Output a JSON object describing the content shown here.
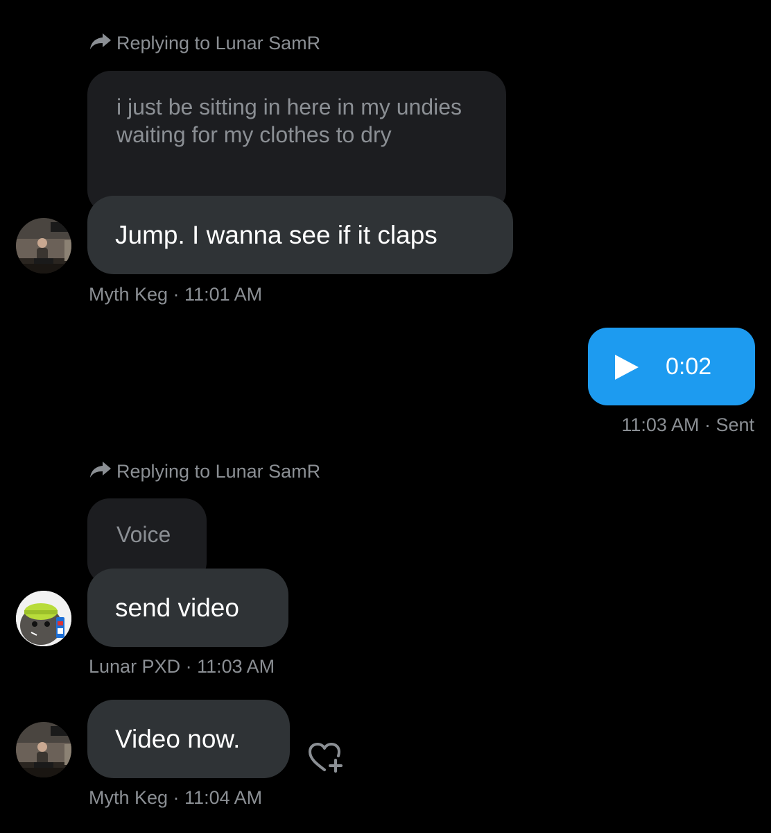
{
  "messages": [
    {
      "reply_prefix": "Replying to Lunar SamR",
      "quoted_text": "i just be sitting in here in my undies waiting for my clothes to dry",
      "text": "Jump. I wanna see if it claps",
      "meta": "Myth Keg · 11:01 AM"
    },
    {
      "voice_duration": "0:02",
      "meta": "11:03 AM · Sent"
    },
    {
      "reply_prefix": "Replying to Lunar SamR",
      "quoted_text": "Voice",
      "text": "send video",
      "meta": "Lunar PXD · 11:03 AM"
    },
    {
      "text": "Video now.",
      "meta": "Myth Keg · 11:04 AM"
    }
  ],
  "colors": {
    "background": "#000000",
    "bubble": "#2f3336",
    "quoted_bubble": "#1c1d20",
    "sent_bubble": "#1d9bf0",
    "muted_text": "#8b8f94"
  },
  "icons": [
    "reply-arrow-icon",
    "play-icon",
    "add-reaction-icon"
  ]
}
